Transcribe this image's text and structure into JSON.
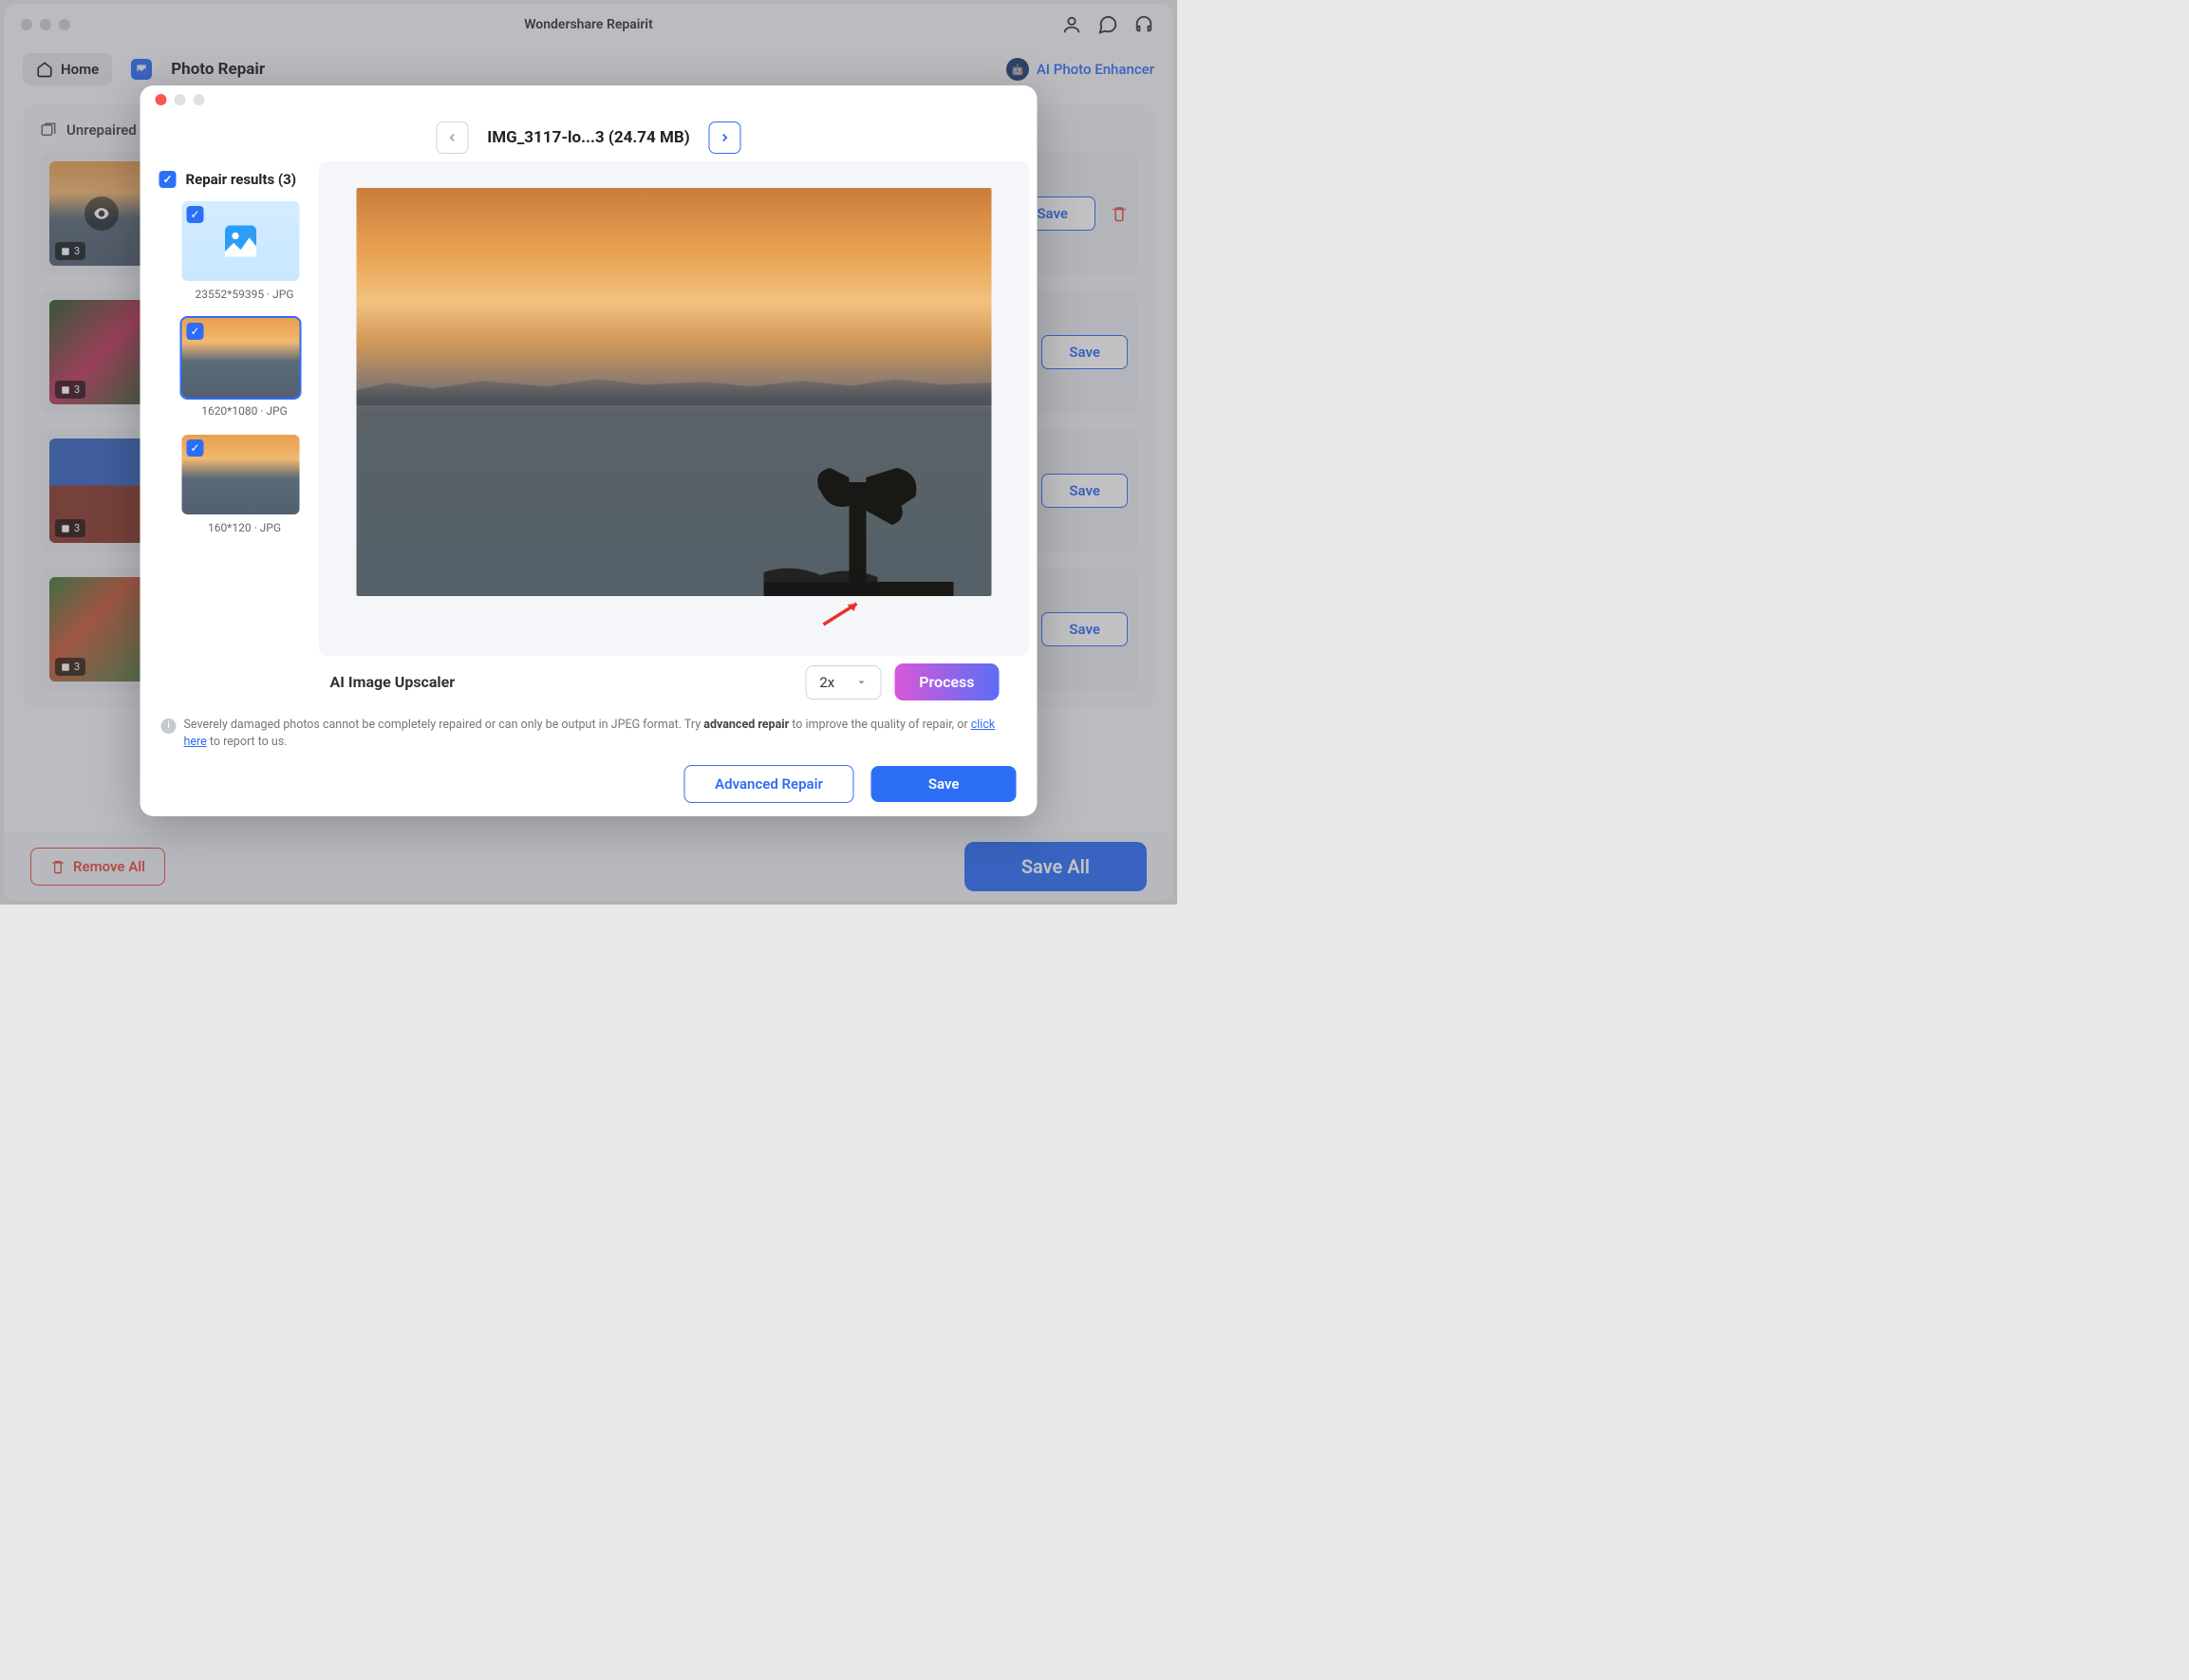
{
  "app": {
    "title": "Wondershare Repairit"
  },
  "header": {
    "home_label": "Home",
    "section_title": "Photo Repair",
    "ai_enhancer": "AI Photo Enhancer"
  },
  "content": {
    "section_label": "Unrepaired",
    "save_label": "Save",
    "rows": [
      {
        "badge": "3"
      },
      {
        "badge": "3"
      },
      {
        "badge": "3"
      },
      {
        "badge": "3"
      }
    ]
  },
  "footer": {
    "remove_all": "Remove All",
    "save_all": "Save All"
  },
  "modal": {
    "filename": "IMG_3117-lo...3 (24.74 MB)",
    "sidebar": {
      "header": "Repair results (3)",
      "items": [
        {
          "label": "23552*59395 · JPG",
          "placeholder": true,
          "selected": false
        },
        {
          "label": "1620*1080 · JPG",
          "placeholder": false,
          "selected": true
        },
        {
          "label": "160*120 · JPG",
          "placeholder": false,
          "selected": false
        }
      ]
    },
    "upscale": {
      "label": "AI Image Upscaler",
      "scale_value": "2x",
      "process_label": "Process"
    },
    "note": {
      "text_a": "Severely damaged photos cannot be completely repaired or can only be output in JPEG format. Try ",
      "bold": "advanced repair",
      "text_b": " to improve the quality of repair, or ",
      "link": "click here",
      "text_c": " to report to us."
    },
    "actions": {
      "advanced": "Advanced Repair",
      "save": "Save"
    }
  }
}
